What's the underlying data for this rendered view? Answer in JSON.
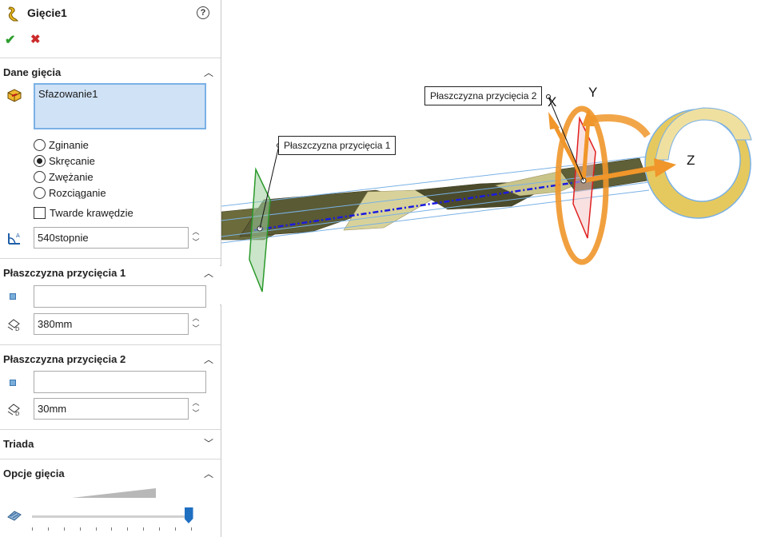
{
  "feature": {
    "title": "Gięcie1"
  },
  "actions": {
    "ok_glyph": "✔",
    "cancel_glyph": "✖",
    "help_glyph": "?"
  },
  "bend_data": {
    "title": "Dane gięcia",
    "selection": "Sfazowanie1",
    "options": [
      {
        "label": "Zginanie",
        "selected": false
      },
      {
        "label": "Skręcanie",
        "selected": true
      },
      {
        "label": "Zwężanie",
        "selected": false
      },
      {
        "label": "Rozciąganie",
        "selected": false
      }
    ],
    "hard_edges_label": "Twarde krawędzie",
    "hard_edges_checked": false,
    "angle_value": "540stopnie"
  },
  "trim_plane_1": {
    "title": "Płaszczyzna przycięcia 1",
    "reference": "",
    "distance": "380mm"
  },
  "trim_plane_2": {
    "title": "Płaszczyzna przycięcia 2",
    "reference": "",
    "distance": "30mm"
  },
  "triad": {
    "title": "Triada"
  },
  "bend_options": {
    "title": "Opcje gięcia",
    "accuracy_level": 0.98
  },
  "viewport": {
    "callout_1": "Płaszczyzna przycięcia 1",
    "callout_2": "Płaszczyzna przycięcia 2",
    "axis_x": "X",
    "axis_y": "Y",
    "axis_z": "Z"
  },
  "colors": {
    "accent": "#7ab1e5",
    "triad_orange": "#f0962a",
    "plane_green": "#2b9a2b",
    "plane_red": "#e02020",
    "axis_blue": "#1a1ae0"
  }
}
